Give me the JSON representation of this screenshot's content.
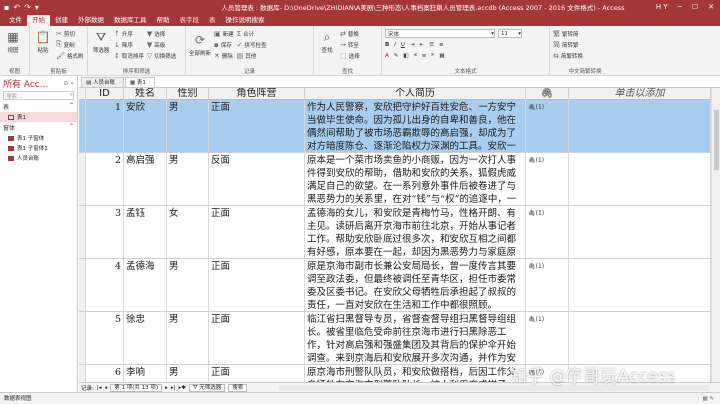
{
  "window": {
    "title": "人员管理表 : 数据库- D:\\OneDrive\\ZHIDIAN\\A美剧\\三种形态\\人事档案狂飙人员管理表.accdb (Access 2007 - 2016 文件格式) - Access",
    "user": "H Y"
  },
  "ribbon": {
    "tabs": [
      "文件",
      "开始",
      "创建",
      "外部数据",
      "数据库工具",
      "帮助",
      "表字段",
      "表",
      "操作说明搜索"
    ],
    "active_tab": "开始",
    "groups": {
      "views": {
        "label": "视图",
        "btn": "视图"
      },
      "clipboard": {
        "label": "剪贴板",
        "paste": "粘贴",
        "cut": "剪切",
        "copy": "复制",
        "format_painter": "格式刷"
      },
      "sort_filter": {
        "label": "排序和筛选",
        "filter": "筛选器",
        "asc": "升序",
        "desc": "降序",
        "clear": "取消排序",
        "selection": "选择",
        "advanced": "高级",
        "toggle": "切换筛选"
      },
      "records": {
        "label": "记录",
        "refresh": "全部刷新",
        "new": "新建",
        "save": "保存",
        "delete": "删除",
        "totals": "合计",
        "spelling": "拼写检查",
        "more": "其他"
      },
      "find": {
        "label": "查找",
        "find": "查找",
        "replace": "替换",
        "goto": "转至",
        "select": "选择"
      },
      "text_format": {
        "label": "文本格式",
        "font": "宋体",
        "size": "11"
      },
      "chinese": {
        "label": "中文简繁转换",
        "t2s": "繁转简",
        "s2t": "简转繁",
        "conv": "简繁转换"
      }
    }
  },
  "nav": {
    "header": "所有 Acc...",
    "search_placeholder": "搜索...",
    "sections": [
      {
        "label": "表",
        "items": [
          "表1"
        ]
      },
      {
        "label": "窗体",
        "items": [
          "表1 子窗体",
          "表1 子窗体1",
          "人员台账"
        ]
      }
    ]
  },
  "doc_tabs": [
    "人员台账",
    "表1"
  ],
  "active_doc_tab": "表1",
  "table": {
    "columns": [
      "ID",
      "姓名",
      "性别",
      "角色阵营",
      "个人简历",
      "",
      "单击以添加"
    ],
    "rows": [
      {
        "id": "1",
        "name": "安欣",
        "sex": "男",
        "camp": "正面",
        "bio": "作为人民警察，安欣把守护好百姓安危、一方安宁当做毕生使命。因为孤儿出身的自卑和善良，他在偶然间帮助了被市场恶霸欺辱的高启强，却成为了对方暗度陈仓、逐渐沦陷权力深渊的工具。安欣一生紧守使命，从不妥协。",
        "att": "(1)",
        "selected": true
      },
      {
        "id": "2",
        "name": "高启强",
        "sex": "男",
        "camp": "反面",
        "bio": "原本是一个菜市场卖鱼的小商贩，因为一次打人事件得到安欣的帮助，借助和安欣的关系，狐假虎威满足自己的欲望。在一系列意外事件后被卷进了与黑恶势力的关系里，在对“钱”与“权”的追逐中，一步一步沦为黑恶势力的头目。",
        "att": "(1)"
      },
      {
        "id": "3",
        "name": "孟钰",
        "sex": "女",
        "camp": "正面",
        "bio": "孟德海的女儿，和安欣是青梅竹马，性格开朗、有主见。读研后离开京海市前往北京，开始从事记者工作。帮助安欣卧底过很多次，和安欣互相之间都有好感，原本要在一起，却因为黑恶势力与家庭原因不得不分开。",
        "att": "(1)"
      },
      {
        "id": "4",
        "name": "孟德海",
        "sex": "男",
        "camp": "正面",
        "bio": "原是京海市副市长兼公安局局长，曾一度传言其要调至政法委，但最终被调任至青华区，担任市委常委及区委书记。在安欣父母牺牲后承担起了叔叔的责任，一直对安欣在生活和工作中都很照顾。",
        "att": "(1)"
      },
      {
        "id": "5",
        "name": "徐忠",
        "sex": "男",
        "camp": "正面",
        "bio": "临江省扫黑督导专员，省督查督导组扫黑督导组组长。被省里临危受命前往京海市进行扫黑除恶工作，针对高启强和强盛集团及其背后的保护伞开始调查。来到京海后和安欣展开多次沟通，并作为安欣最坚实的后盾。",
        "att": "(1)"
      },
      {
        "id": "6",
        "name": "李响",
        "sex": "男",
        "camp": "正面",
        "bio": "原京海市刑警队队员，和安欣做搭档，后因工作父亲牺牲在京海市刑警队队长，被人利用变成棋子。",
        "att": "(1)"
      }
    ]
  },
  "record_nav": {
    "label": "记录:",
    "position": "第 1 项(共 13 项)",
    "filter": "无筛选器",
    "search": "搜索"
  },
  "status": {
    "left": "数据表视图"
  },
  "watermark": "知乎 @宇哥玩Access"
}
